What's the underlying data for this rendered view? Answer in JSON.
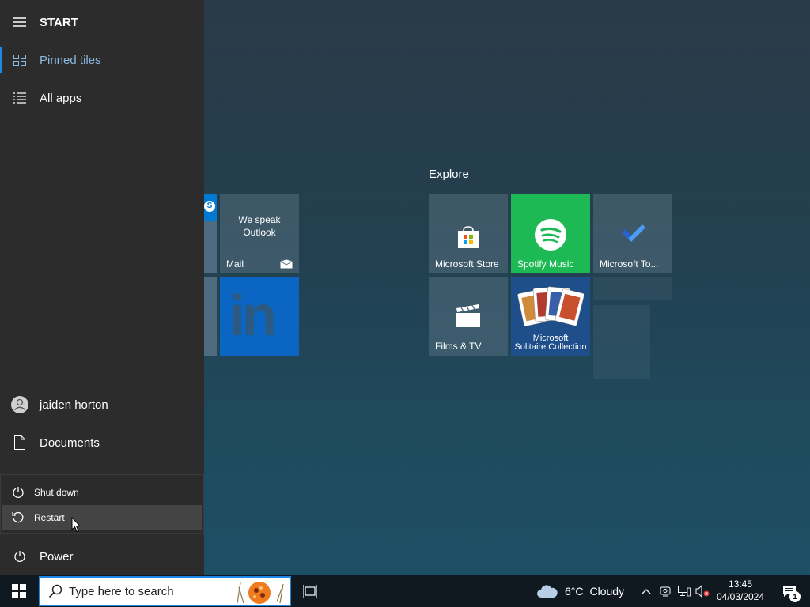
{
  "start": {
    "title": "START",
    "nav": {
      "pinned_tiles": "Pinned tiles",
      "all_apps": "All apps"
    },
    "user_name": "jaiden horton",
    "documents": "Documents",
    "power": "Power",
    "power_menu": {
      "shut_down": "Shut down",
      "restart": "Restart"
    }
  },
  "tiles": {
    "group_explore_title": "Explore",
    "mail": {
      "label": "Mail",
      "line1": "We speak",
      "line2": "Outlook"
    },
    "microsoft_store": {
      "label": "Microsoft Store"
    },
    "spotify": {
      "label": "Spotify Music",
      "color": "#1db954"
    },
    "microsoft_todo": {
      "label": "Microsoft To..."
    },
    "films_tv": {
      "label": "Films & TV"
    },
    "solitaire": {
      "line1": "Microsoft",
      "line2": "Solitaire Collection"
    },
    "linkedin": {
      "color": "#0a66c2"
    }
  },
  "taskbar": {
    "search_placeholder": "Type here to search",
    "weather_temp": "6°C",
    "weather_condition": "Cloudy",
    "time": "13:45",
    "date": "04/03/2024",
    "notification_count": "1",
    "accent": "#1e88e5"
  }
}
